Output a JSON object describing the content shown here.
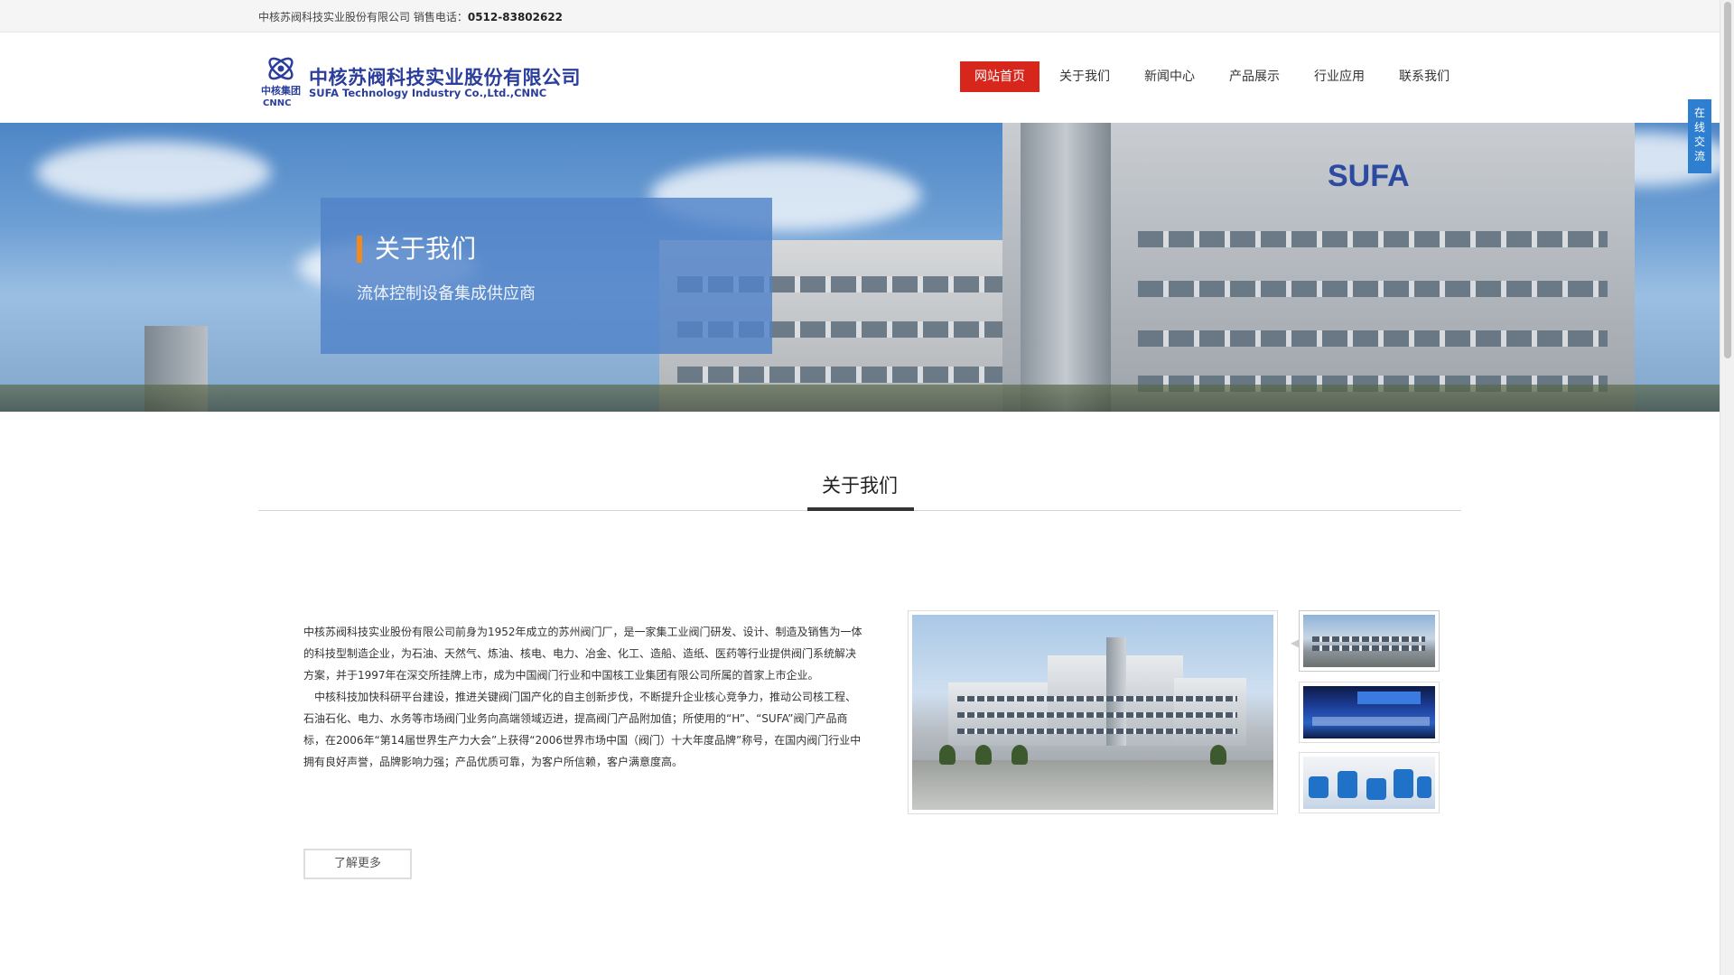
{
  "topbar": {
    "company": "中核苏阀科技实业股份有限公司",
    "phone_label": "销售电话：",
    "phone": "0512-83802622"
  },
  "logo": {
    "group_cn": "中核集团",
    "group_en": "CNNC",
    "name_cn": "中核苏阀科技实业股份有限公司",
    "name_en": "SUFA Technology Industry Co.,Ltd.,CNNC"
  },
  "nav": {
    "items": [
      {
        "label": "网站首页",
        "active": true
      },
      {
        "label": "关于我们",
        "active": false
      },
      {
        "label": "新闻中心",
        "active": false
      },
      {
        "label": "产品展示",
        "active": false
      },
      {
        "label": "行业应用",
        "active": false
      },
      {
        "label": "联系我们",
        "active": false
      }
    ]
  },
  "banner": {
    "title": "关于我们",
    "subtitle": "流体控制设备集成供应商",
    "roof_sign": "SUFA"
  },
  "section": {
    "title": "关于我们",
    "paragraph1": "中核苏阀科技实业股份有限公司前身为1952年成立的苏州阀门厂，是一家集工业阀门研发、设计、制造及销售为一体的科技型制造企业，为石油、天然气、炼油、核电、电力、冶金、化工、造船、造纸、医药等行业提供阀门系统解决方案，并于1997年在深交所挂牌上市，成为中国阀门行业和中国核工业集团有限公司所属的首家上市企业。",
    "paragraph2": "中核科技加快科研平台建设，推进关键阀门国产化的自主创新步伐，不断提升企业核心竞争力，推动公司核工程、石油石化、电力、水务等市场阀门业务向高端领域迈进，提高阀门产品附加值；所使用的“H”、“SUFA”阀门产品商标，在2006年“第14届世界生产力大会”上获得“2006世界市场中国（阀门）十大年度品牌”称号，在国内阀门行业中拥有良好声誉，品牌影响力强；产品优质可靠，为客户所信赖，客户满意度高。",
    "more_button": "了解更多"
  },
  "float": {
    "chat_chars": [
      "在",
      "线",
      "交",
      "流"
    ]
  },
  "colors": {
    "nav_active": "#d7271d",
    "brand_blue": "#2b3e9c",
    "accent_orange": "#f08a1c",
    "float_blue": "#2f7fd0"
  }
}
